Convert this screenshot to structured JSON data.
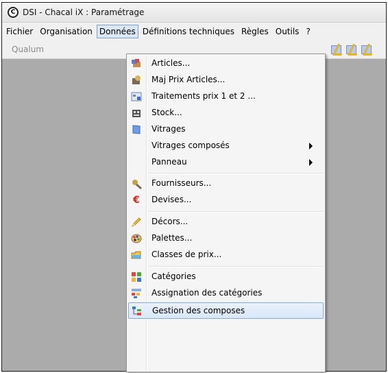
{
  "window": {
    "title": "DSI - Chacal iX : Paramétrage",
    "app_icon_glyph": "C"
  },
  "menubar": {
    "items": [
      {
        "label": "Fichier"
      },
      {
        "label": "Organisation"
      },
      {
        "label": "Données"
      },
      {
        "label": "Définitions techniques"
      },
      {
        "label": "Règles"
      },
      {
        "label": "Outils"
      },
      {
        "label": "?"
      }
    ],
    "active_index": 2
  },
  "toolbar": {
    "combo_value": "Qualum"
  },
  "dropdown": {
    "items": [
      {
        "label": "Articles...",
        "icon": "articles-icon"
      },
      {
        "label": "Maj Prix Articles...",
        "icon": "price-update-icon"
      },
      {
        "label": "Traitements prix 1 et 2 ...",
        "icon": "price-processing-icon"
      },
      {
        "label": "Stock...",
        "icon": "stock-icon"
      },
      {
        "label": "Vitrages",
        "icon": "glazing-icon"
      },
      {
        "label": "Vitrages composés",
        "submenu": true
      },
      {
        "label": "Panneau",
        "submenu": true
      },
      {
        "label": "Fournisseurs...",
        "icon": "suppliers-icon"
      },
      {
        "label": "Devises...",
        "icon": "euro-icon",
        "icon_glyph": "€"
      },
      {
        "label": "Décors...",
        "icon": "pencil-icon"
      },
      {
        "label": "Palettes...",
        "icon": "palette-icon"
      },
      {
        "label": "Classes de prix...",
        "icon": "price-class-icon"
      },
      {
        "label": "Catégories",
        "icon": "categories-icon"
      },
      {
        "label": "Assignation des catégories",
        "icon": "category-assign-icon"
      },
      {
        "label": "Gestion des composes",
        "icon": "compose-management-icon",
        "highlighted": true
      }
    ]
  },
  "colors": {
    "workspace": "#ababab",
    "highlight_border": "#86a9d6",
    "highlight_fill": "#d9e7f8",
    "euro_red": "#d22a18"
  }
}
